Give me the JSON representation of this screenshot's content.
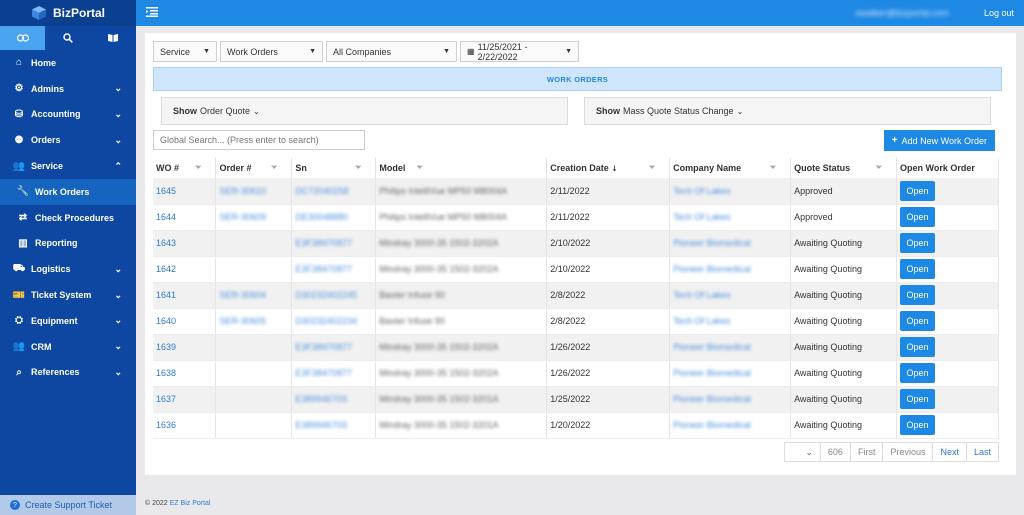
{
  "brand": {
    "name": "BizPortal"
  },
  "sidebar": {
    "icon_tabs": [
      {
        "icon": "link-icon",
        "glyph": "🔗"
      },
      {
        "icon": "search-icon",
        "glyph": "🔍"
      },
      {
        "icon": "book-icon",
        "glyph": "📖"
      }
    ],
    "items": [
      {
        "label": "Home",
        "icon": "⌂",
        "chevron": ""
      },
      {
        "label": "Admins",
        "icon": "⚙",
        "chevron": "⌄"
      },
      {
        "label": "Accounting",
        "icon": "⛁",
        "chevron": "⌄"
      },
      {
        "label": "Orders",
        "icon": "⚉",
        "chevron": "⌄"
      },
      {
        "label": "Service",
        "icon": "👥",
        "chevron": "⌃"
      },
      {
        "label": "Work Orders",
        "icon": "🔧",
        "chevron": ""
      },
      {
        "label": "Check Procedures",
        "icon": "⇄",
        "chevron": ""
      },
      {
        "label": "Reporting",
        "icon": "▥",
        "chevron": ""
      },
      {
        "label": "Logistics",
        "icon": "⛟",
        "chevron": "⌄"
      },
      {
        "label": "Ticket System",
        "icon": "🎫",
        "chevron": "⌄"
      },
      {
        "label": "Equipment",
        "icon": "⛭",
        "chevron": "⌄"
      },
      {
        "label": "CRM",
        "icon": "👥",
        "chevron": "⌄"
      },
      {
        "label": "References",
        "icon": "⌕",
        "chevron": "⌄"
      }
    ],
    "support_label": "Create Support Ticket"
  },
  "topbar": {
    "user_email": "ewalker@bizportal.com",
    "logout_label": "Log out"
  },
  "filters": {
    "service": "Service",
    "work_orders": "Work Orders",
    "companies": "All Companies",
    "date_range": "11/25/2021 - 2/22/2022"
  },
  "section_title": "WORK ORDERS",
  "toggles": {
    "order_quote_bold": "Show",
    "order_quote_rest": "Order Quote",
    "mass_quote_bold": "Show",
    "mass_quote_rest": "Mass Quote Status Change"
  },
  "search": {
    "placeholder": "Global Search... (Press enter to search)"
  },
  "add_button_label": "Add New Work Order",
  "table": {
    "headers": [
      "WO #",
      "Order #",
      "Sn",
      "Model",
      "Creation Date",
      "Company Name",
      "Quote Status",
      "Open Work Order"
    ],
    "rows": [
      {
        "wo": "1645",
        "order": "SER-30610",
        "sn": "DC72040258",
        "model": "Philips IntelliVue MP50 M8004A",
        "date": "2/11/2022",
        "company": "Tech Of Lakes",
        "status": "Approved"
      },
      {
        "wo": "1644",
        "order": "SER-30609",
        "sn": "DE30048880",
        "model": "Philips IntelliVue MP50 M8004A",
        "date": "2/11/2022",
        "company": "Tech Of Lakes",
        "status": "Approved"
      },
      {
        "wo": "1643",
        "order": "",
        "sn": "E3F38470877",
        "model": "Mindray 3000-35 1502-3202A",
        "date": "2/10/2022",
        "company": "Pioneer Biomedical",
        "status": "Awaiting Quoting"
      },
      {
        "wo": "1642",
        "order": "",
        "sn": "E3F38470877",
        "model": "Mindray 3000-35 1502-3202A",
        "date": "2/10/2022",
        "company": "Pioneer Biomedical",
        "status": "Awaiting Quoting"
      },
      {
        "wo": "1641",
        "order": "SER-30604",
        "sn": "D30232402245",
        "model": "Baxter Infuse 90",
        "date": "2/8/2022",
        "company": "Tech Of Lakes",
        "status": "Awaiting Quoting"
      },
      {
        "wo": "1640",
        "order": "SER-30605",
        "sn": "D30232402234",
        "model": "Baxter Infuse 90",
        "date": "2/8/2022",
        "company": "Tech Of Lakes",
        "status": "Awaiting Quoting"
      },
      {
        "wo": "1639",
        "order": "",
        "sn": "E3F38470877",
        "model": "Mindray 3000-35 1502-3202A",
        "date": "1/26/2022",
        "company": "Pioneer Biomedical",
        "status": "Awaiting Quoting"
      },
      {
        "wo": "1638",
        "order": "",
        "sn": "E3F38470877",
        "model": "Mindray 3000-35 1502-3202A",
        "date": "1/26/2022",
        "company": "Pioneer Biomedical",
        "status": "Awaiting Quoting"
      },
      {
        "wo": "1637",
        "order": "",
        "sn": "E38994670S",
        "model": "Mindray 3000-35 1502-3201A",
        "date": "1/25/2022",
        "company": "Pioneer Biomedical",
        "status": "Awaiting Quoting"
      },
      {
        "wo": "1636",
        "order": "",
        "sn": "E38994670S",
        "model": "Mindray 3000-35 1502-3201A",
        "date": "1/20/2022",
        "company": "Pioneer Biomedical",
        "status": "Awaiting Quoting"
      }
    ],
    "open_label": "Open"
  },
  "pager": {
    "page_count": "606",
    "first": "First",
    "previous": "Previous",
    "next": "Next",
    "last": "Last"
  },
  "footer": {
    "copyright": "© 2022",
    "brand_link": "EZ Biz Portal"
  },
  "colors": {
    "sidebar": "#0d47a1",
    "topbar": "#1e88e5",
    "accent": "#1e88e5"
  }
}
